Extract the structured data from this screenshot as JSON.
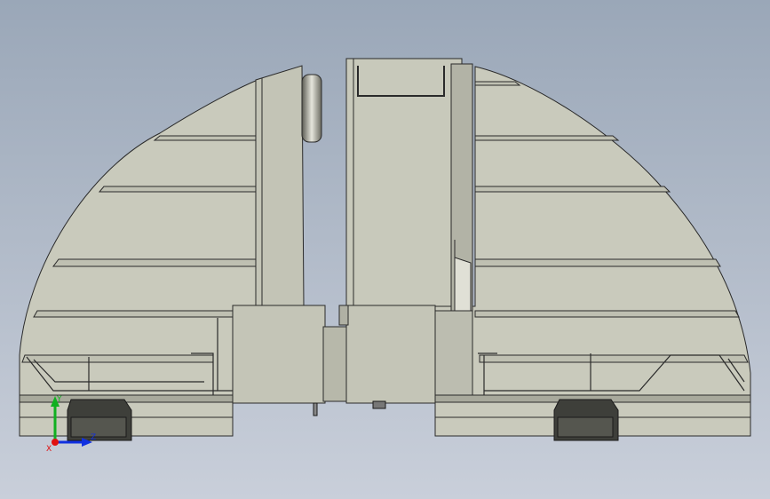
{
  "viewport": {
    "background_top": "#9aa7b8",
    "background_bottom": "#c9cfda",
    "part_fill": "#c9cabc",
    "part_shade": "#b4b5a8",
    "edge_color": "#2a2a2a"
  },
  "triad": {
    "x_label": "X",
    "y_label": "Y",
    "z_label": "Z",
    "x_color": "#e01010",
    "y_color": "#10b020",
    "z_color": "#1030e0"
  }
}
